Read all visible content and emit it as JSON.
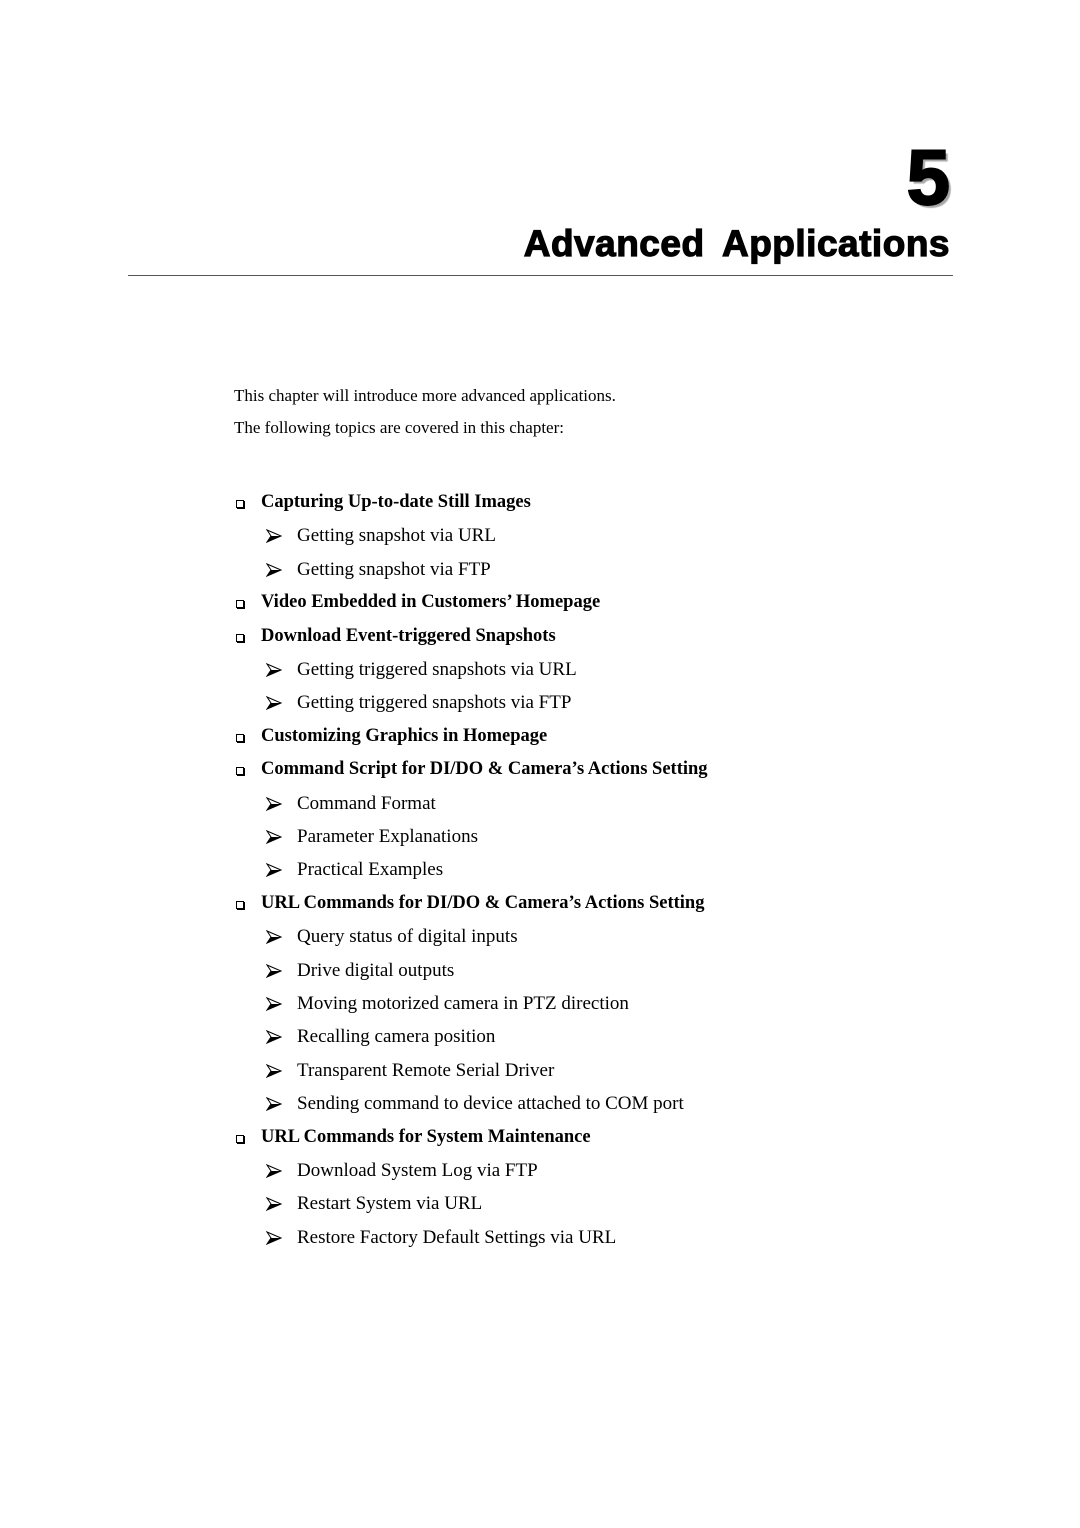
{
  "chapter": {
    "number": "5",
    "title": "Advanced Applications"
  },
  "intro": {
    "line1": "This chapter will introduce more advanced applications.",
    "line2": "The following topics are covered in this chapter:"
  },
  "icons": {
    "section_bullet": "hollow-square-bullet-icon",
    "item_bullet": "arrowhead-bullet-icon"
  },
  "topics": [
    {
      "title": "Capturing Up-to-date Still Images",
      "items": [
        "Getting snapshot via URL",
        "Getting snapshot via FTP"
      ]
    },
    {
      "title": "Video Embedded in Customers’ Homepage",
      "items": []
    },
    {
      "title": "Download Event-triggered Snapshots",
      "items": [
        "Getting triggered snapshots via URL",
        "Getting triggered snapshots via FTP"
      ]
    },
    {
      "title": "Customizing Graphics in Homepage",
      "items": []
    },
    {
      "title": "Command Script for DI/DO & Camera’s Actions Setting",
      "items": [
        "Command Format",
        "Parameter Explanations",
        "Practical Examples"
      ]
    },
    {
      "title": "URL Commands for DI/DO & Camera’s Actions Setting",
      "items": [
        "Query status of digital inputs",
        "Drive digital outputs",
        "Moving motorized camera in PTZ direction",
        "Recalling camera position",
        "Transparent Remote Serial Driver",
        "Sending command to device attached to COM port"
      ]
    },
    {
      "title": "URL Commands for System Maintenance",
      "items": [
        "Download System Log via FTP",
        "Restart System via URL",
        "Restore Factory Default Settings via URL"
      ]
    }
  ]
}
